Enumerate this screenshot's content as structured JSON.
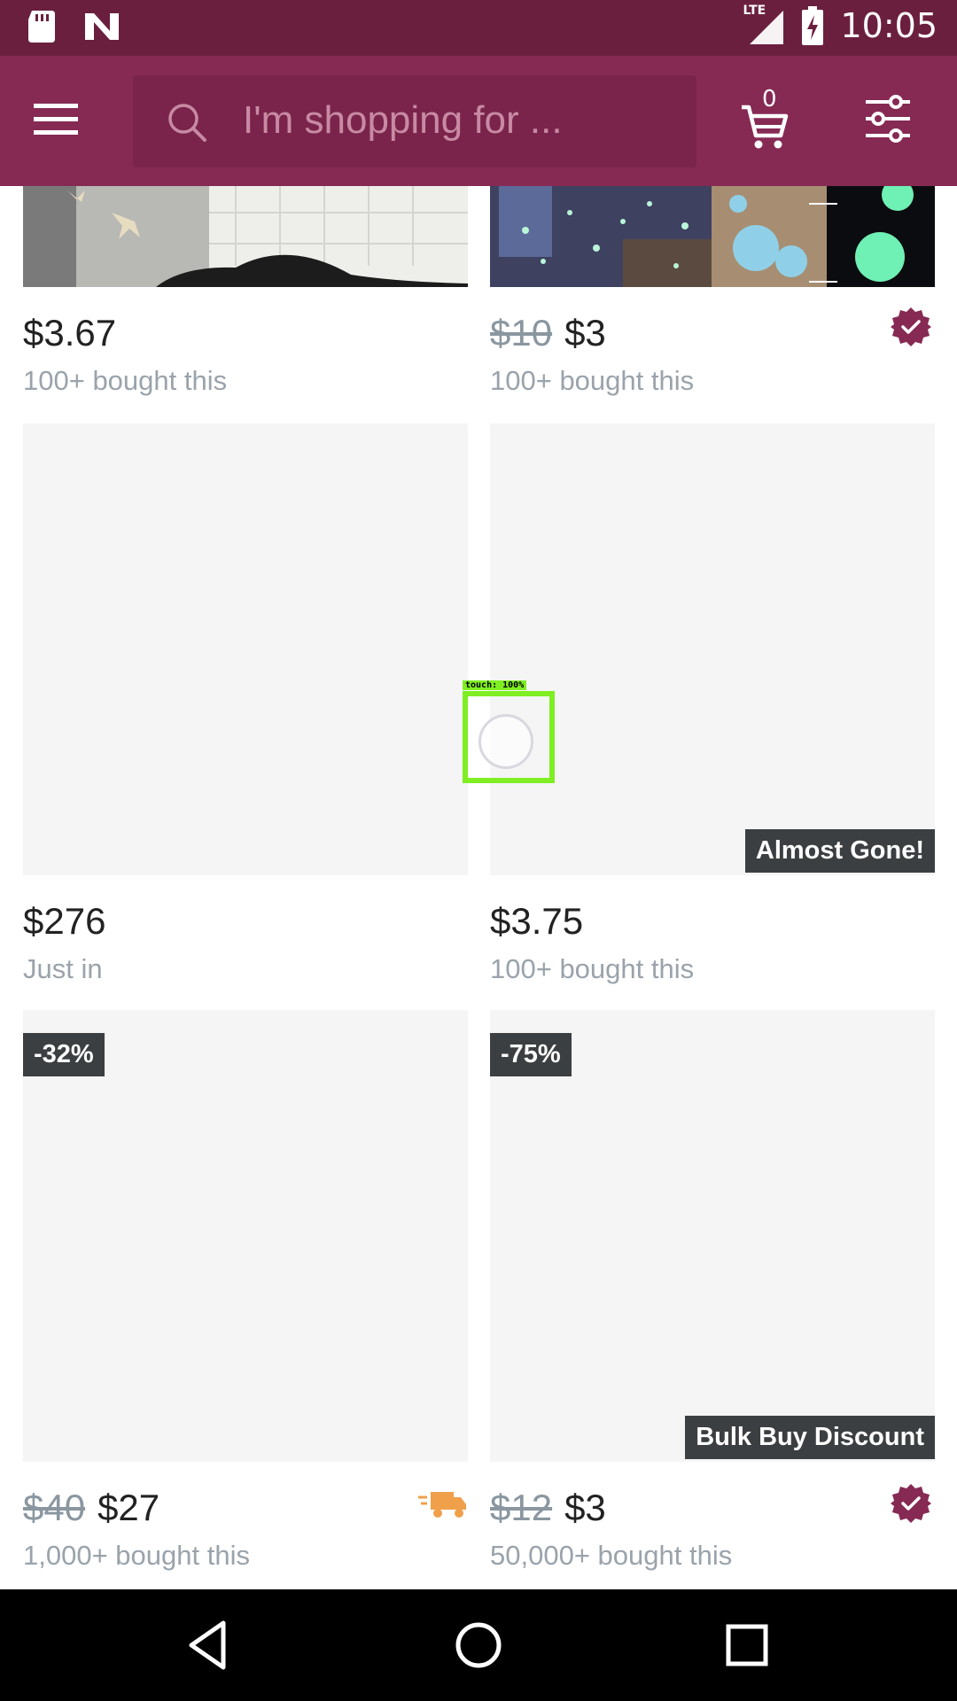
{
  "status_bar": {
    "time": "10:05",
    "network": "LTE",
    "icons": [
      "sd-card-icon",
      "n-logo-icon",
      "signal-icon",
      "battery-charging-icon"
    ]
  },
  "header": {
    "search_placeholder": "I'm shopping for ...",
    "cart_count": "0",
    "colors": {
      "status_bar": "#6b1f3e",
      "app_bar": "#862a54",
      "search_box": "#7a244c"
    }
  },
  "products": [
    {
      "price": "$3.67",
      "old_price": "",
      "sub": "100+ bought this",
      "badge": "",
      "discount": "",
      "verified": false,
      "shipping": false
    },
    {
      "price": "$3",
      "old_price": "$10",
      "sub": "100+ bought this",
      "badge": "",
      "discount": "",
      "verified": true,
      "shipping": false
    },
    {
      "price": "$276",
      "old_price": "",
      "sub": "Just in",
      "badge": "",
      "discount": "",
      "verified": false,
      "shipping": false
    },
    {
      "price": "$3.75",
      "old_price": "",
      "sub": "100+ bought this",
      "badge": "Almost Gone!",
      "discount": "",
      "verified": false,
      "shipping": false
    },
    {
      "price": "$27",
      "old_price": "$40",
      "sub": "1,000+ bought this",
      "badge": "",
      "discount": "-32%",
      "verified": false,
      "shipping": true
    },
    {
      "price": "$3",
      "old_price": "$12",
      "sub": "50,000+ bought this",
      "badge": "Bulk Buy Discount",
      "discount": "-75%",
      "verified": true,
      "shipping": false
    }
  ],
  "touch_indicator": {
    "label": "touch: 100%"
  },
  "accent_colors": {
    "verified": "#862a54",
    "shipping": "#f0a04b",
    "badge_bg": "#3c3f42"
  }
}
